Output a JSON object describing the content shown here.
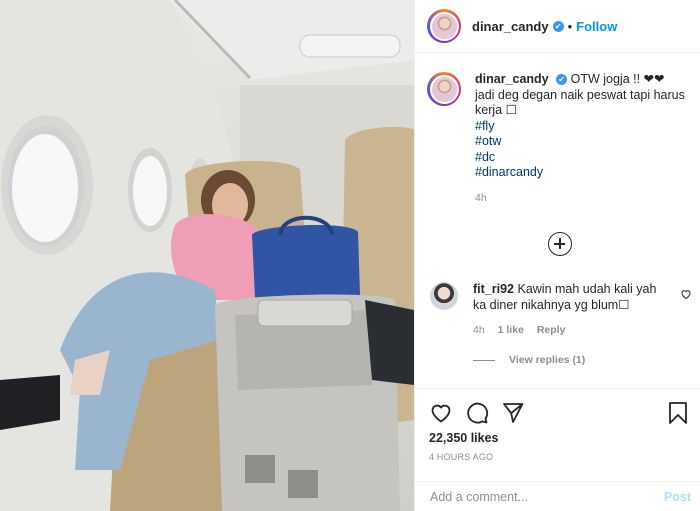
{
  "post": {
    "username": "dinar_candy",
    "follow_label": "Follow",
    "dot": "•",
    "verified_glyph": "✔"
  },
  "caption": {
    "username": "dinar_candy",
    "text_line1": "OTW jogja !! ❤❤",
    "text_line2": "jadi deg degan naik peswat tapi harus kerja ☐",
    "hashtags": [
      "#fly",
      "#otw",
      "#dc",
      "#dinarcandy"
    ],
    "time": "4h"
  },
  "comment": {
    "username": "fit_ri92",
    "text": "Kawin mah udah kali yah ka diner nikahnya yg blum☐",
    "time": "4h",
    "likes": "1 like",
    "reply": "Reply",
    "view_replies": "View replies (1)"
  },
  "stats": {
    "likes": "22,350 likes",
    "posted": "4 HOURS AGO"
  },
  "comment_box": {
    "placeholder": "Add a comment...",
    "post_label": "Post"
  },
  "colors": {
    "accent": "#0095f6",
    "post_disabled": "#b2dffc",
    "hashtag": "#00376b",
    "muted": "#8e8e8e"
  },
  "icons": [
    "verified-icon",
    "load-more-icon",
    "heart-icon",
    "comment-icon",
    "share-icon",
    "bookmark-icon"
  ]
}
